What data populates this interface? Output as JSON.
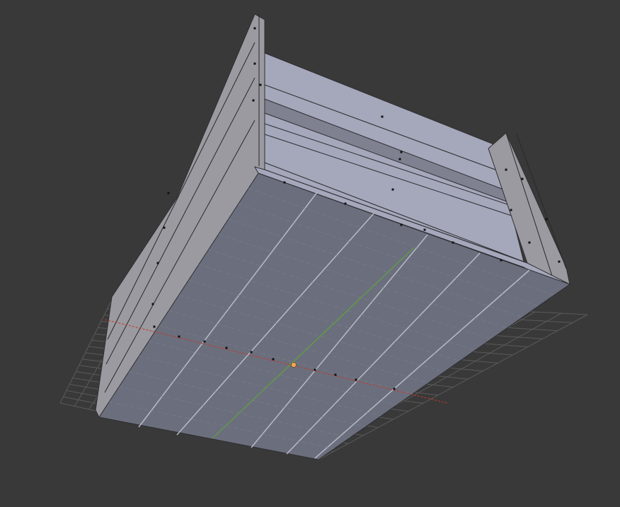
{
  "viewport": {
    "mode": "3d-viewport",
    "background_color": "#393939",
    "grid_color": "#5a5a5a",
    "x_axis_color": "#c0392b",
    "y_axis_color": "#5fa33a",
    "selected_origin_color": "#f5a34a",
    "mesh_face_color": "#a5a7bb",
    "mesh_bottom_color": "#6b6f7d",
    "object": "crate-mesh"
  }
}
